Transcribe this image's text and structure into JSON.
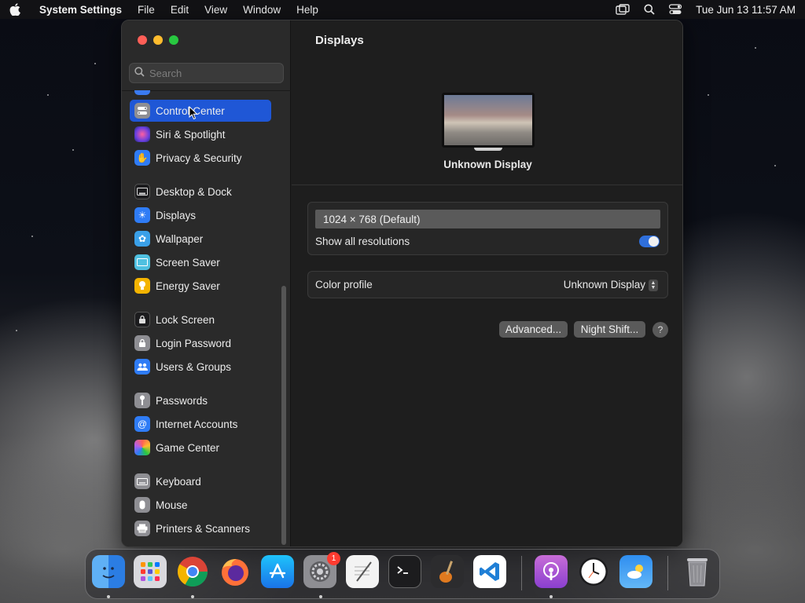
{
  "menubar": {
    "app_name": "System Settings",
    "items": [
      "File",
      "Edit",
      "View",
      "Window",
      "Help"
    ],
    "clock": "Tue Jun 13  11:57 AM"
  },
  "window": {
    "search": {
      "placeholder": "Search",
      "value": ""
    },
    "sidebar": {
      "items": [
        {
          "label": "Control Center",
          "icon": "control-center-icon",
          "color": "#8e8e93",
          "selected": true
        },
        {
          "label": "Siri & Spotlight",
          "icon": "siri-icon",
          "color": "#7b3fe4"
        },
        {
          "label": "Privacy & Security",
          "icon": "hand-icon",
          "color": "#2f7cf6"
        },
        {
          "label": "Desktop & Dock",
          "icon": "dock-icon",
          "color": "#1c1c1e"
        },
        {
          "label": "Displays",
          "icon": "sun-icon",
          "color": "#2f7cf6"
        },
        {
          "label": "Wallpaper",
          "icon": "flower-icon",
          "color": "#3aa0e8"
        },
        {
          "label": "Screen Saver",
          "icon": "screen-saver-icon",
          "color": "#4fc0e0"
        },
        {
          "label": "Energy Saver",
          "icon": "bulb-icon",
          "color": "#f4b400"
        },
        {
          "label": "Lock Screen",
          "icon": "lock-icon",
          "color": "#1c1c1e"
        },
        {
          "label": "Login Password",
          "icon": "padlock-icon",
          "color": "#8e8e93"
        },
        {
          "label": "Users & Groups",
          "icon": "users-icon",
          "color": "#2f7cf6"
        },
        {
          "label": "Passwords",
          "icon": "key-icon",
          "color": "#8e8e93"
        },
        {
          "label": "Internet Accounts",
          "icon": "at-icon",
          "color": "#2f7cf6"
        },
        {
          "label": "Game Center",
          "icon": "game-center-icon",
          "color": "#e8e8e8"
        },
        {
          "label": "Keyboard",
          "icon": "keyboard-icon",
          "color": "#8e8e93"
        },
        {
          "label": "Mouse",
          "icon": "mouse-icon",
          "color": "#8e8e93"
        },
        {
          "label": "Printers & Scanners",
          "icon": "printer-icon",
          "color": "#8e8e93"
        }
      ]
    },
    "main": {
      "title": "Displays",
      "display_name": "Unknown Display",
      "resolution": "1024 × 768 (Default)",
      "show_all_label": "Show all resolutions",
      "show_all_enabled": true,
      "color_profile_label": "Color profile",
      "color_profile_value": "Unknown Display",
      "advanced_label": "Advanced...",
      "night_shift_label": "Night Shift...",
      "help_label": "?"
    }
  },
  "dock": {
    "apps": [
      {
        "name": "finder-icon",
        "running": true
      },
      {
        "name": "launchpad-icon",
        "running": false
      },
      {
        "name": "chrome-icon",
        "running": true
      },
      {
        "name": "firefox-icon",
        "running": false
      },
      {
        "name": "app-store-icon",
        "running": false
      },
      {
        "name": "system-settings-icon",
        "running": true,
        "badge": "1"
      },
      {
        "name": "textedit-icon",
        "running": false
      },
      {
        "name": "terminal-icon",
        "running": false
      },
      {
        "name": "garageband-icon",
        "running": false
      },
      {
        "name": "vscode-icon",
        "running": false
      },
      {
        "name": "podcasts-icon",
        "running": true
      },
      {
        "name": "clock-icon",
        "running": false
      },
      {
        "name": "weather-icon",
        "running": false
      },
      {
        "name": "trash-icon",
        "running": false
      }
    ]
  },
  "colors": {
    "accent": "#1f57d6",
    "toggle": "#2f6fdb"
  }
}
